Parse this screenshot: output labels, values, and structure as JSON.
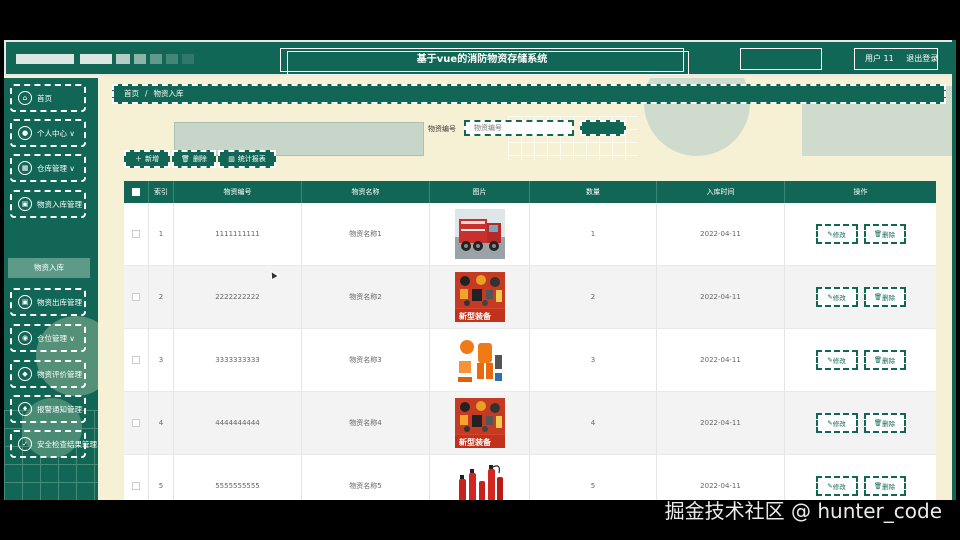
{
  "header": {
    "title": "基于vue的消防物资存储系统",
    "user": "用户 11",
    "logout": "退出登录"
  },
  "sidebar": {
    "items": [
      {
        "label": "首页",
        "icon": "home-icon"
      },
      {
        "label": "个人中心 ∨",
        "icon": "user-icon"
      },
      {
        "label": "仓库管理 ∨",
        "icon": "grid-icon"
      },
      {
        "label": "物资入库管理",
        "icon": "box-icon"
      },
      {
        "label": "物资出库管理",
        "icon": "box-out-icon"
      },
      {
        "label": "仓位管理 ∨",
        "icon": "location-icon"
      },
      {
        "label": "物资评价管理",
        "icon": "shield-icon"
      },
      {
        "label": "报警通知管理",
        "icon": "bell-icon"
      },
      {
        "label": "安全检查结果管理",
        "icon": "check-icon"
      }
    ],
    "submenu_active": "物资入库"
  },
  "breadcrumb": {
    "home": "首页",
    "separator": "/",
    "current": "物资入库"
  },
  "search": {
    "label": "物资编号",
    "placeholder": "物资编号"
  },
  "toolbar": {
    "add": "新增",
    "delete": "删除",
    "report": "统计报表"
  },
  "table": {
    "headers": [
      "索引",
      "物资编号",
      "物资名称",
      "图片",
      "数量",
      "入库时间",
      "操作"
    ],
    "rows": [
      {
        "index": "1",
        "code": "1111111111",
        "name": "物资名称1",
        "image": "fire-truck",
        "qty": "1",
        "date": "2022-04-11"
      },
      {
        "index": "2",
        "code": "2222222222",
        "name": "物资名称2",
        "image": "equipment-set",
        "qty": "2",
        "date": "2022-04-11"
      },
      {
        "index": "3",
        "code": "3333333333",
        "name": "物资名称3",
        "image": "protective-suit",
        "qty": "3",
        "date": "2022-04-11"
      },
      {
        "index": "4",
        "code": "4444444444",
        "name": "物资名称4",
        "image": "equipment-set",
        "qty": "4",
        "date": "2022-04-11"
      },
      {
        "index": "5",
        "code": "5555555555",
        "name": "物资名称5",
        "image": "extinguishers",
        "qty": "5",
        "date": "2022-04-11"
      }
    ],
    "edit_label": "修改",
    "delete_label": "删除"
  },
  "image_text": {
    "equipment_banner": "新型装备"
  },
  "watermark": "掘金技术社区 @ hunter_code",
  "colors": {
    "primary": "#116655",
    "background": "#f6f1d5",
    "accent_light": "#cfdccd"
  }
}
